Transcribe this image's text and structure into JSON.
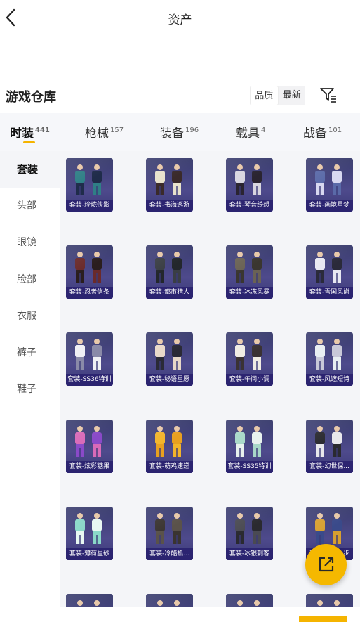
{
  "header": {
    "title": "资产"
  },
  "section": {
    "title": "游戏仓库",
    "sort_options": [
      "品质",
      "最新"
    ],
    "active_sort": 1
  },
  "tabs": [
    {
      "label": "时装",
      "count": "441",
      "active": true
    },
    {
      "label": "枪械",
      "count": "157"
    },
    {
      "label": "装备",
      "count": "196"
    },
    {
      "label": "载具",
      "count": "4"
    },
    {
      "label": "战备",
      "count": "101"
    }
  ],
  "sidebar": {
    "items": [
      "套装",
      "头部",
      "眼镜",
      "脸部",
      "衣服",
      "裤子",
      "鞋子"
    ],
    "active_index": 0
  },
  "grid": {
    "items": [
      {
        "label": "套装-玲珑侠影",
        "palette": [
          "#2f7f86",
          "#1f2c4a"
        ]
      },
      {
        "label": "套装-书海巡游",
        "palette": [
          "#e8e2cc",
          "#3a2a2a"
        ]
      },
      {
        "label": "套装-琴音绮想",
        "palette": [
          "#d8d6e0",
          "#2a2430"
        ]
      },
      {
        "label": "套装-画境星梦",
        "palette": [
          "#5a6aa8",
          "#d8d8f0"
        ]
      },
      {
        "label": "套装-忍者信条",
        "palette": [
          "#6a2a2a",
          "#2a1e1e"
        ]
      },
      {
        "label": "套装-都市猎人",
        "palette": [
          "#3a3e44",
          "#23272c"
        ]
      },
      {
        "label": "套装-冰冻风暴",
        "palette": [
          "#6a6254",
          "#3a3630"
        ]
      },
      {
        "label": "套装-雪国风尚",
        "palette": [
          "#e8e8f2",
          "#2a2a3a"
        ]
      },
      {
        "label": "套装-SS36特训",
        "palette": [
          "#f0f0f4",
          "#8a8aa8"
        ]
      },
      {
        "label": "套装-秘语星愿",
        "palette": [
          "#e8d8c8",
          "#2a2a36"
        ]
      },
      {
        "label": "套装-午间小调",
        "palette": [
          "#f0ece4",
          "#3a3234"
        ]
      },
      {
        "label": "套装-风遮短诗",
        "palette": [
          "#e8eef2",
          "#c8c8d8"
        ]
      },
      {
        "label": "套装-炫彩糖果",
        "palette": [
          "#d86ab8",
          "#8a4ac8"
        ]
      },
      {
        "label": "套装-萌鸡速递",
        "palette": [
          "#f2b42a",
          "#e8a020"
        ]
      },
      {
        "label": "套装-SS35特训",
        "palette": [
          "#a8d8c8",
          "#e8f2ee"
        ]
      },
      {
        "label": "套装-幻世保...",
        "palette": [
          "#2a2a30",
          "#e8e8ec"
        ]
      },
      {
        "label": "套装-薄荷星砂",
        "palette": [
          "#8ad8c8",
          "#e8f8f2"
        ]
      },
      {
        "label": "套装-冷酷抓...",
        "palette": [
          "#3a3430",
          "#5a524a"
        ]
      },
      {
        "label": "套装-冰银刺客",
        "palette": [
          "#4a4a52",
          "#2a2a30"
        ]
      },
      {
        "label": "套装-迷踪...步",
        "palette": [
          "#d8a030",
          "#3a4a8a"
        ]
      },
      {
        "label": "",
        "palette": [
          "#c8c8d0",
          "#5a5a66"
        ]
      },
      {
        "label": "",
        "palette": [
          "#3a3a40",
          "#6a6a72"
        ]
      },
      {
        "label": "",
        "palette": [
          "#a8d8e8",
          "#e8f2f8"
        ]
      },
      {
        "label": "",
        "palette": [
          "#8a5a3a",
          "#4a3a30"
        ]
      }
    ]
  },
  "colors": {
    "accent": "#f5b400",
    "card_bg": "#3f3e7e",
    "label_bg": "#28206e",
    "grid_bg": "#f4f5f8",
    "tab_bg": "#f6f7fa"
  },
  "icons": {
    "back": "back-arrow-icon",
    "filter": "filter-icon",
    "fab": "share-external-icon"
  }
}
